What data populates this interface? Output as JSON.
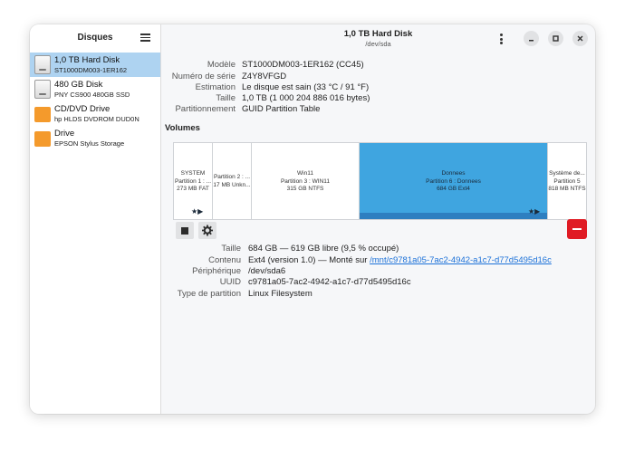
{
  "sidebar": {
    "title": "Disques",
    "disks": [
      {
        "name": "1,0 TB Hard Disk",
        "model": "ST1000DM003-1ER162",
        "icon": "hard-disk-icon"
      },
      {
        "name": "480 GB Disk",
        "model": "PNY CS900 480GB SSD",
        "icon": "hard-disk-icon"
      },
      {
        "name": "CD/DVD Drive",
        "model": "hp HLDS  DVDROM DUD0N",
        "icon": "optical-drive-icon"
      },
      {
        "name": "Drive",
        "model": "EPSON Stylus Storage",
        "icon": "optical-drive-icon"
      }
    ]
  },
  "header": {
    "title": "1,0 TB Hard Disk",
    "subtitle": "/dev/sda"
  },
  "disk_info": {
    "labels": [
      "Modèle",
      "Numéro de série",
      "Estimation",
      "Taille",
      "Partitionnement"
    ],
    "values": [
      "ST1000DM003-1ER162 (CC45)",
      "Z4Y8VFGD",
      "Le disque est sain (33 °C / 91 °F)",
      "1,0 TB (1 000 204 886 016 bytes)",
      "GUID Partition Table"
    ]
  },
  "volumes": {
    "title": "Volumes",
    "partitions": [
      {
        "lines": [
          "SYSTEM",
          "Partition 1 : ...",
          "273 MB FAT"
        ]
      },
      {
        "lines": [
          "Partition 2 : ...",
          "17 MB Unkn..."
        ]
      },
      {
        "lines": [
          "Win11",
          "Partition 3 : WIN11",
          "315 GB NTFS"
        ]
      },
      {
        "lines": [
          "Donnees",
          "Partition 6 : Donnees",
          "684 GB Ext4"
        ]
      },
      {
        "lines": [
          "Système de...",
          "Partition 5",
          "818 MB NTFS"
        ]
      }
    ],
    "stars_symbol": "★▶"
  },
  "volume_info": {
    "labels": [
      "Taille",
      "Contenu",
      "Périphérique",
      "UUID",
      "Type de partition"
    ],
    "size": "684 GB — 619 GB libre (9,5 % occupé)",
    "content_prefix": "Ext4 (version 1.0) — Monté sur ",
    "mount_link": "/mnt/c9781a05-7ac2-4942-a1c7-d77d5495d16c",
    "device": "/dev/sda6",
    "uuid": "c9781a05-7ac2-4942-a1c7-d77d5495d16c",
    "partition_type": "Linux Filesystem"
  },
  "colors": {
    "selection": "#aed3f1",
    "partition_selected": "#3fa5e0",
    "delete": "#e01b24",
    "optical": "#f49a2c"
  }
}
